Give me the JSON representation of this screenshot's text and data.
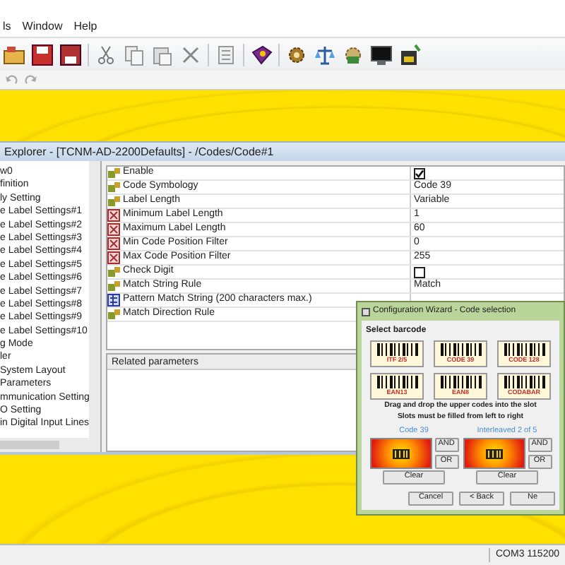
{
  "menu": [
    "ls",
    "Window",
    "Help"
  ],
  "explorer": {
    "title": "Explorer - [TCNM-AD-2200Defaults] - /Codes/Code#1",
    "tree": [
      "w0",
      "finition",
      "ly Setting",
      "e Label Settings#1",
      "e Label Settings#2",
      "e Label Settings#3",
      "e Label Settings#4",
      "e Label Settings#5",
      "e Label Settings#6",
      "e Label Settings#7",
      "e Label Settings#8",
      "e Label Settings#9",
      "e Label Settings#10",
      "g Mode",
      "ler",
      "System Layout",
      "Parameters",
      "mmunication Setting",
      "O Setting",
      "in Digital Input Lines"
    ],
    "parameters": [
      {
        "kind": "checkbox",
        "name": "Enable",
        "checked": true
      },
      {
        "kind": "text",
        "name": "Code Symbology",
        "value": "Code 39"
      },
      {
        "kind": "text",
        "name": "Label Length",
        "value": "Variable"
      },
      {
        "kind": "range",
        "name": "Minimum Label Length",
        "value": "1"
      },
      {
        "kind": "range",
        "name": "Maximum Label Length",
        "value": "60"
      },
      {
        "kind": "range",
        "name": "Min Code Position Filter",
        "value": "0"
      },
      {
        "kind": "range",
        "name": "Max Code Position Filter",
        "value": "255"
      },
      {
        "kind": "checkbox",
        "name": "Check Digit",
        "checked": false
      },
      {
        "kind": "text",
        "name": "Match String Rule",
        "value": "Match"
      },
      {
        "kind": "pattern",
        "name": "Pattern Match String (200 characters max.)"
      },
      {
        "kind": "rule",
        "name": "Match Direction Rule"
      }
    ],
    "related_header": "Related parameters"
  },
  "wizard": {
    "title": "Configuration Wizard - Code selection",
    "section": "Select barcode",
    "barcodes": [
      "ITF 2/5",
      "CODE 39",
      "CODE 128",
      "EAN13",
      "EAN8",
      "CODABAR"
    ],
    "instructions": [
      "Drag and drop the upper codes into the slot",
      "Slots must be filled from left to right"
    ],
    "slots": [
      {
        "label": "Code 39",
        "operators": [
          "AND",
          "OR"
        ],
        "clear": "Clear"
      },
      {
        "label": "Interleaved 2 of 5",
        "operators": [
          "AND",
          "OR"
        ],
        "clear": "Clear"
      }
    ],
    "buttons": [
      "Cancel",
      "< Back",
      "Ne"
    ]
  },
  "status_bar": {
    "port": "COM3 115200"
  }
}
